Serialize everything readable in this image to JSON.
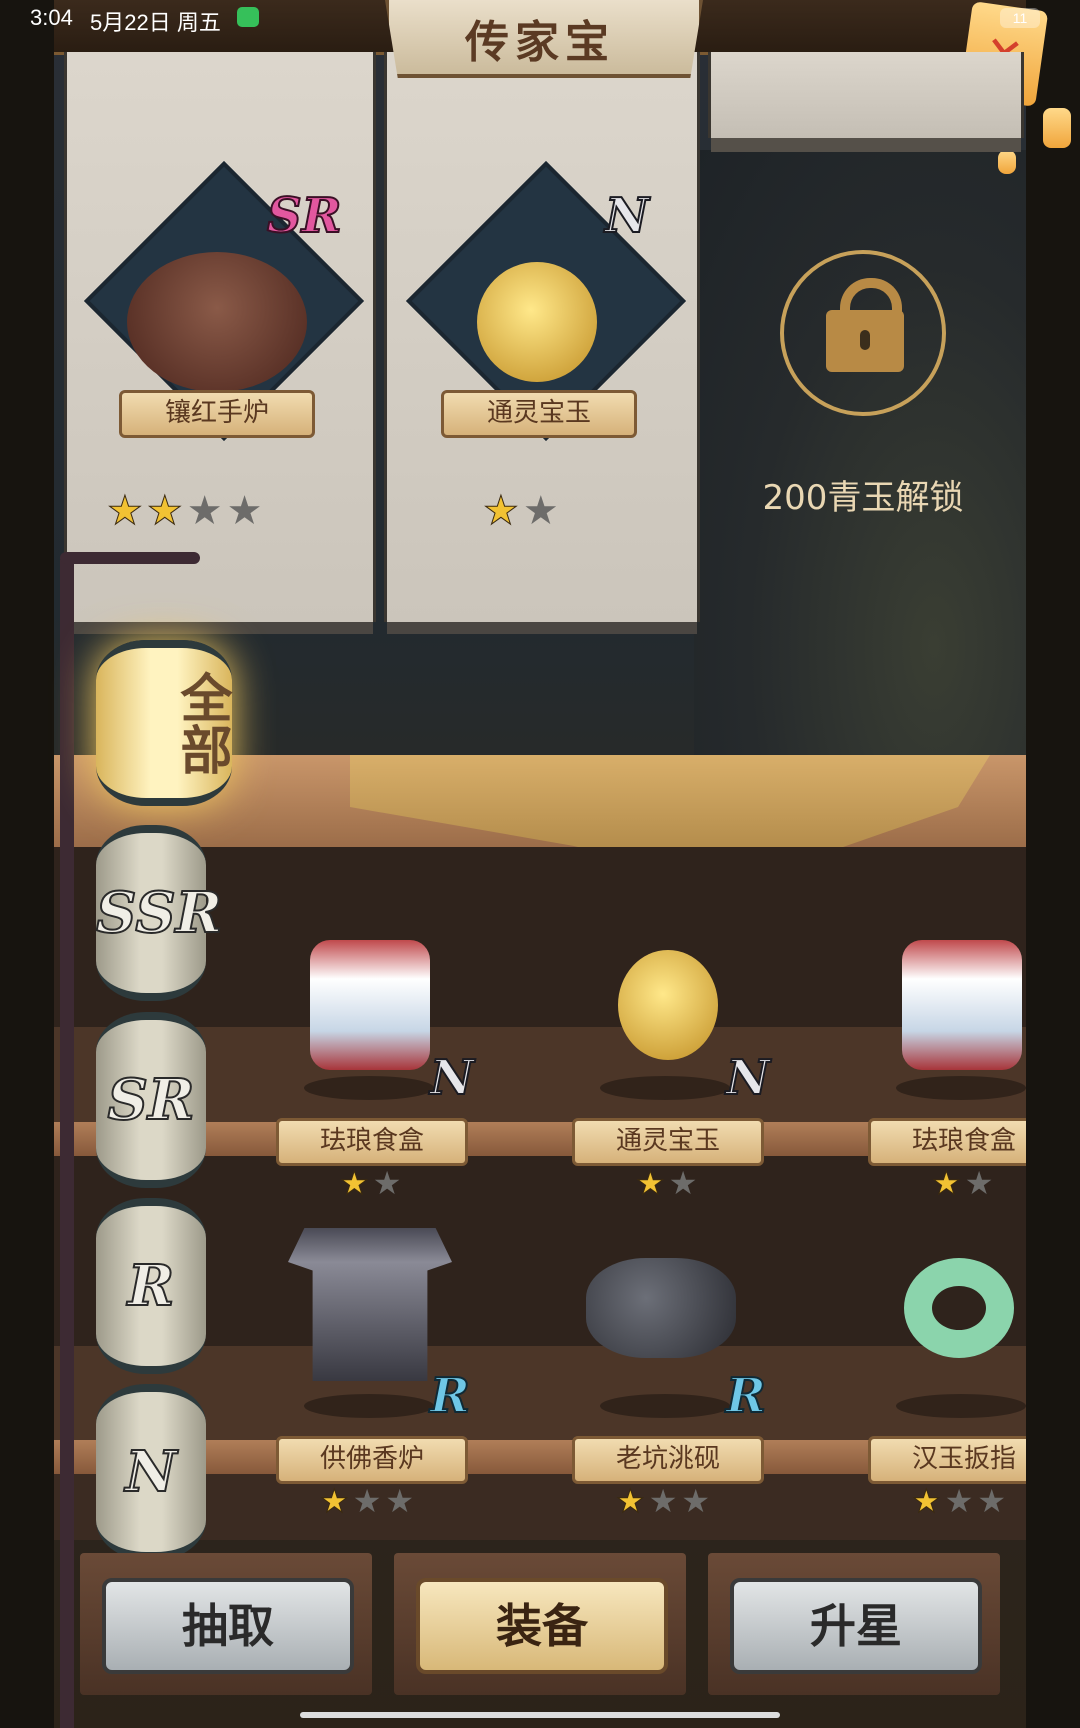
{
  "status_bar": {
    "time": "3:04",
    "date": "5月22日 周五",
    "battery": "11"
  },
  "header": {
    "title": "传家宝"
  },
  "equipped": [
    {
      "name": "镶红手炉",
      "rarity": "SR",
      "stars": {
        "filled": 2,
        "total": 4
      }
    },
    {
      "name": "通灵宝玉",
      "rarity": "N",
      "stars": {
        "filled": 1,
        "total": 2
      }
    }
  ],
  "locked_slot": {
    "unlock_text": "200青玉解锁"
  },
  "filters": {
    "all": "全部",
    "ssr": "SSR",
    "sr": "SR",
    "r": "R",
    "n": "N",
    "selected": "全部"
  },
  "shelf": {
    "row1": [
      {
        "name": "珐琅食盒",
        "rarity": "N",
        "stars": {
          "filled": 1,
          "total": 2
        }
      },
      {
        "name": "通灵宝玉",
        "rarity": "N",
        "stars": {
          "filled": 1,
          "total": 2
        }
      },
      {
        "name": "珐琅食盒",
        "rarity": "N",
        "stars": {
          "filled": 1,
          "total": 2
        }
      }
    ],
    "row2": [
      {
        "name": "供佛香炉",
        "rarity": "R",
        "stars": {
          "filled": 1,
          "total": 3
        }
      },
      {
        "name": "老坑洮砚",
        "rarity": "R",
        "stars": {
          "filled": 1,
          "total": 3
        }
      },
      {
        "name": "汉玉扳指",
        "rarity": "R",
        "stars": {
          "filled": 1,
          "total": 3
        }
      }
    ]
  },
  "buttons": {
    "draw": "抽取",
    "equip": "装备",
    "upgrade": "升星",
    "active": "装备"
  },
  "colors": {
    "accent_gold": "#c7a15a",
    "sr_pink": "#e2579f",
    "r_blue": "#6fc7e6"
  }
}
